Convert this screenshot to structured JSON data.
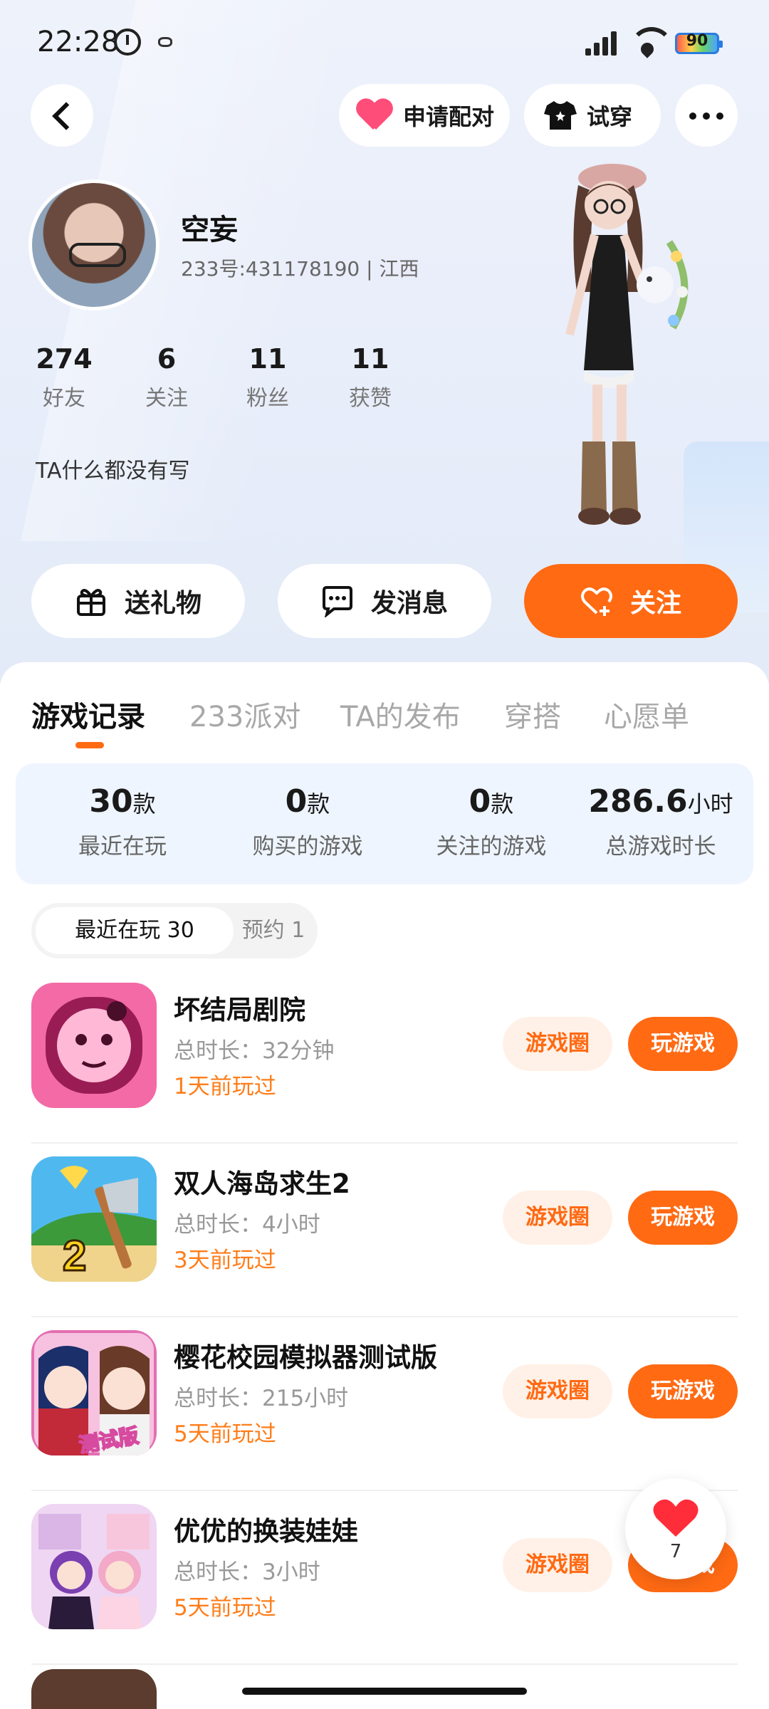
{
  "status_bar": {
    "time": "22:28",
    "battery": "90"
  },
  "top_bar": {
    "match_label": "申请配对",
    "tryon_label": "试穿"
  },
  "profile": {
    "name": "空妄",
    "id_line": "233号:431178190 | 江西",
    "stats": [
      {
        "value": "274",
        "label": "好友"
      },
      {
        "value": "6",
        "label": "关注"
      },
      {
        "value": "11",
        "label": "粉丝"
      },
      {
        "value": "11",
        "label": "获赞"
      }
    ],
    "bio": "TA什么都没有写"
  },
  "actions": {
    "gift": "送礼物",
    "message": "发消息",
    "follow": "关注"
  },
  "tabs": [
    "游戏记录",
    "233派对",
    "TA的发布",
    "穿搭",
    "心愿单"
  ],
  "summary": [
    {
      "value": "30",
      "unit": "款",
      "caption": "最近在玩"
    },
    {
      "value": "0",
      "unit": "款",
      "caption": "购买的游戏"
    },
    {
      "value": "0",
      "unit": "款",
      "caption": "关注的游戏"
    },
    {
      "value": "286.6",
      "unit": "小时",
      "caption": "总游戏时长"
    }
  ],
  "filters": {
    "recent": "最近在玩 30",
    "reserve": "预约 1"
  },
  "games": [
    {
      "title": "坏结局剧院",
      "duration": "总时长：32分钟",
      "last_played": "1天前玩过",
      "circle": "游戏圈",
      "play": "玩游戏"
    },
    {
      "title": "双人海岛求生2",
      "duration": "总时长：4小时",
      "last_played": "3天前玩过",
      "circle": "游戏圈",
      "play": "玩游戏"
    },
    {
      "title": "樱花校园模拟器测试版",
      "duration": "总时长：215小时",
      "last_played": "5天前玩过",
      "circle": "游戏圈",
      "play": "玩游戏"
    },
    {
      "title": "优优的换装娃娃",
      "duration": "总时长：3小时",
      "last_played": "5天前玩过",
      "circle": "游戏圈",
      "play": "玩游戏"
    }
  ],
  "icon_text": {
    "game2_badge": "2",
    "game3_badge": "测试版"
  },
  "fab": {
    "count": "7"
  },
  "colors": {
    "accent": "#ff6a13",
    "last_played": "#ff7d1a",
    "heart": "#ff4d7a"
  }
}
